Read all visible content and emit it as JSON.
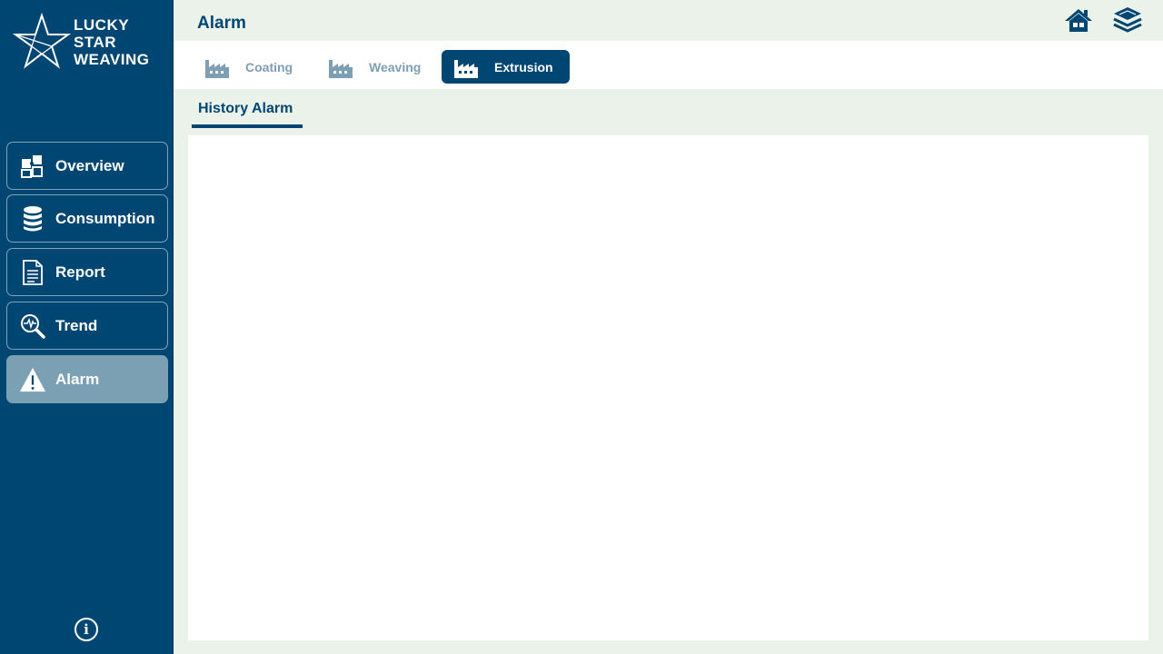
{
  "brand": {
    "line1": "LUCKY",
    "line2": "STAR",
    "line3": "WEAVING"
  },
  "header": {
    "title": "Alarm"
  },
  "top_icons": [
    "home-icon",
    "layers-icon"
  ],
  "nav": {
    "items": [
      {
        "label": "Overview",
        "icon": "puzzle-icon",
        "active": false
      },
      {
        "label": "Consumption",
        "icon": "database-icon",
        "active": false
      },
      {
        "label": "Report",
        "icon": "document-icon",
        "active": false
      },
      {
        "label": "Trend",
        "icon": "magnifier-pulse-icon",
        "active": false
      },
      {
        "label": "Alarm",
        "icon": "warning-icon",
        "active": true
      }
    ]
  },
  "tabs": [
    {
      "label": "Coating",
      "icon": "factory-icon",
      "active": false
    },
    {
      "label": "Weaving",
      "icon": "factory-icon",
      "active": false
    },
    {
      "label": "Extrusion",
      "icon": "factory-icon",
      "active": true
    }
  ],
  "subtab": {
    "label": "History Alarm"
  },
  "info": {
    "symbol": "i"
  },
  "colors": {
    "primary": "#004673",
    "background": "#eaf2ea",
    "active_nav": "#7b9fb3",
    "inactive_tab": "#7e9eb3"
  }
}
